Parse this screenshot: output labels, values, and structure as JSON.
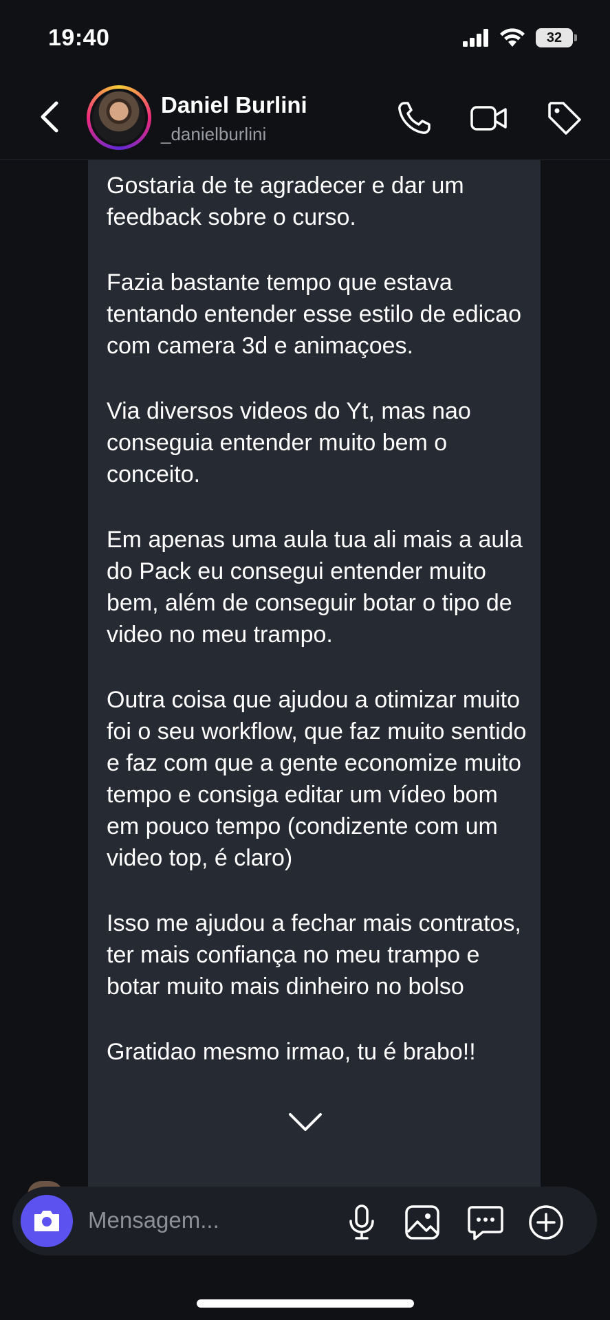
{
  "status_bar": {
    "time": "19:40",
    "battery_level": "32",
    "icons": [
      "signal-icon",
      "wifi-icon",
      "battery-icon"
    ]
  },
  "header": {
    "contact_name": "Daniel Burlini",
    "contact_handle": "_danielburlini",
    "icons": [
      "back-icon",
      "phone-icon",
      "video-icon",
      "tag-icon"
    ]
  },
  "chat": {
    "paragraphs": [
      "Gostaria de te agradecer e dar um feedback sobre o curso.",
      "Fazia bastante tempo que estava tentando entender esse estilo de edicao com camera 3d e animaçoes.",
      "Via diversos videos do Yt, mas nao conseguia entender muito bem o conceito.",
      "Em apenas uma aula tua ali mais a aula do Pack eu consegui entender muito bem, além de conseguir botar o tipo de video no meu trampo.",
      "Outra coisa que ajudou a otimizar muito foi o seu workflow, que faz muito sentido e faz com que a gente economize muito tempo e consiga editar um vídeo bom em pouco tempo (condizente com um video top, é claro)",
      "Isso me ajudou a fechar mais contratos, ter mais confiança no meu trampo e botar muito mais dinheiro no bolso",
      "Gratidao mesmo irmao, tu é brabo!!"
    ]
  },
  "composer": {
    "placeholder": "Mensagem...",
    "icons": [
      "camera-icon",
      "microphone-icon",
      "image-icon",
      "sticker-icon",
      "plus-icon"
    ]
  },
  "colors": {
    "background": "#0f1115",
    "bubble": "#262a33",
    "camera_button": "#5b52f0",
    "secondary_text": "#9a9ca3"
  }
}
